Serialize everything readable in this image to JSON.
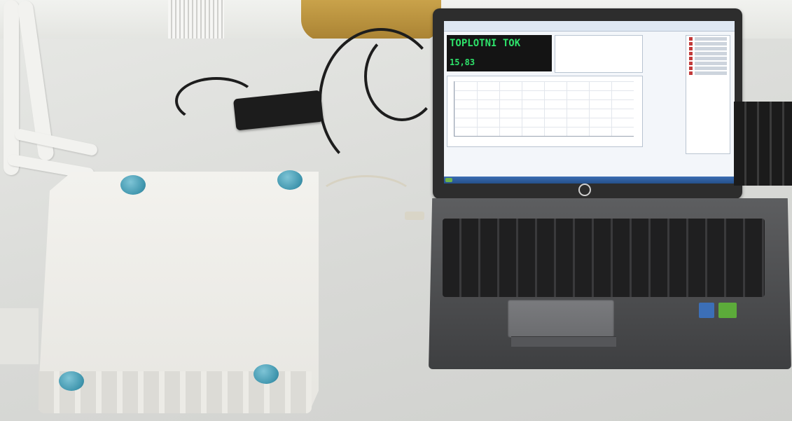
{
  "screen": {
    "readout_title": "TOPLOTNI TOK",
    "readout_value": "15,83"
  },
  "colors": {
    "readout_text": "#2ee26a",
    "readout_bg": "#141414",
    "feet": "#3f95ad",
    "laptop_body": "#4b4c4e"
  },
  "icons": [
    "hp-logo-icon",
    "start-button-icon"
  ]
}
